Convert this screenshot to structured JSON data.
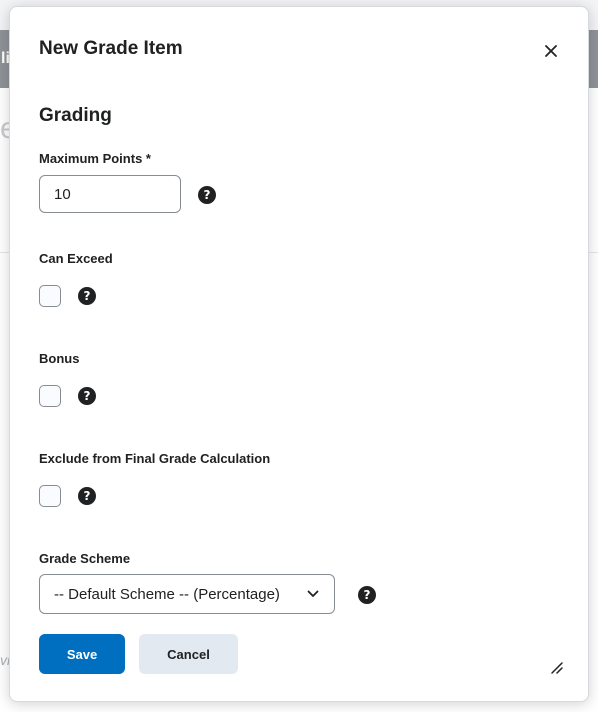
{
  "background": {
    "top_text": "li",
    "large_letter": "e",
    "bottom_text": "vi"
  },
  "dialog": {
    "title": "New Grade Item",
    "close_icon": "close-icon",
    "section_heading": "Grading",
    "max_points": {
      "label": "Maximum Points *",
      "value": "10",
      "help_icon": "help-icon"
    },
    "can_exceed": {
      "label": "Can Exceed",
      "checked": false,
      "help_icon": "help-icon"
    },
    "bonus": {
      "label": "Bonus",
      "checked": false,
      "help_icon": "help-icon"
    },
    "exclude_final": {
      "label": "Exclude from Final Grade Calculation",
      "checked": false,
      "help_icon": "help-icon"
    },
    "grade_scheme": {
      "label": "Grade Scheme",
      "selected": "-- Default Scheme -- (Percentage)",
      "help_icon": "help-icon"
    },
    "buttons": {
      "save": "Save",
      "cancel": "Cancel"
    },
    "help_glyph": "?",
    "colors": {
      "primary": "#006fbf",
      "secondary_button": "#e3e9f1",
      "text": "#202122",
      "border": "#868c91"
    }
  }
}
